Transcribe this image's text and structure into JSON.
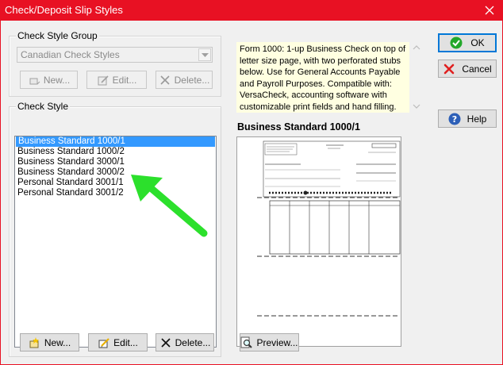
{
  "window": {
    "title": "Check/Deposit Slip Styles"
  },
  "check_style_group": {
    "label": "Check Style Group",
    "selected": "Canadian Check Styles",
    "buttons": {
      "new": "New...",
      "edit": "Edit...",
      "delete": "Delete..."
    }
  },
  "check_style": {
    "label": "Check Style",
    "items": [
      "Business Standard 1000/1",
      "Business Standard 1000/2",
      "Business Standard 3000/1",
      "Business Standard 3000/2",
      "Personal Standard 3001/1",
      "Personal Standard 3001/2"
    ],
    "selected_index": 0,
    "buttons": {
      "new": "New...",
      "edit": "Edit...",
      "delete": "Delete..."
    }
  },
  "description": "Form 1000: 1-up Business Check on top of letter size page, with two perforated stubs below. Use for General Accounts Payable and Payroll Purposes. Compatible with: VersaCheck, accounting software with customizable print fields and hand filling.",
  "preview": {
    "title": "Business Standard 1000/1",
    "button": "Preview..."
  },
  "actions": {
    "ok": "OK",
    "cancel": "Cancel",
    "help": "Help"
  },
  "colors": {
    "titlebar": "#e81123",
    "selection": "#3399ff",
    "description_bg": "#ffffe1",
    "annotation_arrow": "#22dd22"
  }
}
